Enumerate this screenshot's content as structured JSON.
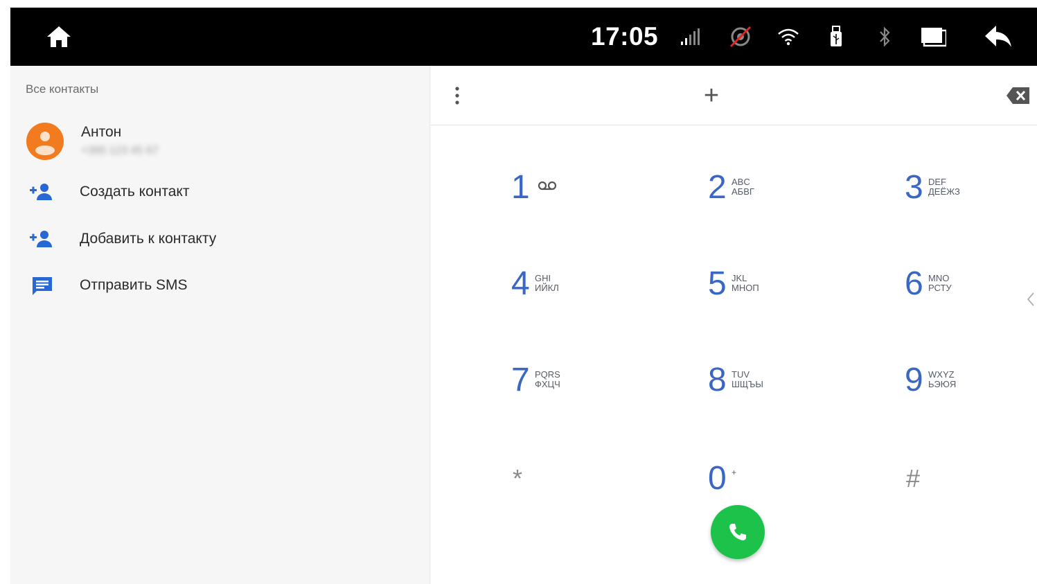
{
  "status_bar": {
    "time": "17:05",
    "icons": [
      "home-icon",
      "signal-icon",
      "gps-off-icon",
      "wifi-icon",
      "usb-icon",
      "bluetooth-icon",
      "display-icon",
      "back-icon"
    ]
  },
  "contacts_pane": {
    "header": "Все контакты",
    "contact": {
      "name": "Антон",
      "number": "+380 123 45 67"
    },
    "actions": [
      {
        "label": "Создать контакт",
        "icon": "add-person-icon"
      },
      {
        "label": "Добавить к контакту",
        "icon": "add-person-icon"
      },
      {
        "label": "Отправить SMS",
        "icon": "message-icon"
      }
    ]
  },
  "dialer": {
    "input_prefix": "+",
    "keys": [
      {
        "digit": "1",
        "letters": "",
        "icon": "voicemail-icon"
      },
      {
        "digit": "2",
        "letters": "ABC\nАБВГ"
      },
      {
        "digit": "3",
        "letters": "DEF\nДЕЁЖЗ"
      },
      {
        "digit": "4",
        "letters": "GHI\nИЙКЛ"
      },
      {
        "digit": "5",
        "letters": "JKL\nМНОП"
      },
      {
        "digit": "6",
        "letters": "MNO\nРСТУ"
      },
      {
        "digit": "7",
        "letters": "PQRS\nФХЦЧ"
      },
      {
        "digit": "8",
        "letters": "TUV\nШЩЪЫ"
      },
      {
        "digit": "9",
        "letters": "WXYZ\nЬЭЮЯ"
      },
      {
        "digit": "*",
        "letters": ""
      },
      {
        "digit": "0",
        "letters": "+"
      },
      {
        "digit": "#",
        "letters": ""
      }
    ]
  },
  "colors": {
    "accent_blue": "#3a66c4",
    "call_green": "#1dc24a",
    "avatar_orange": "#f27b20",
    "status_bar": "#000000"
  }
}
